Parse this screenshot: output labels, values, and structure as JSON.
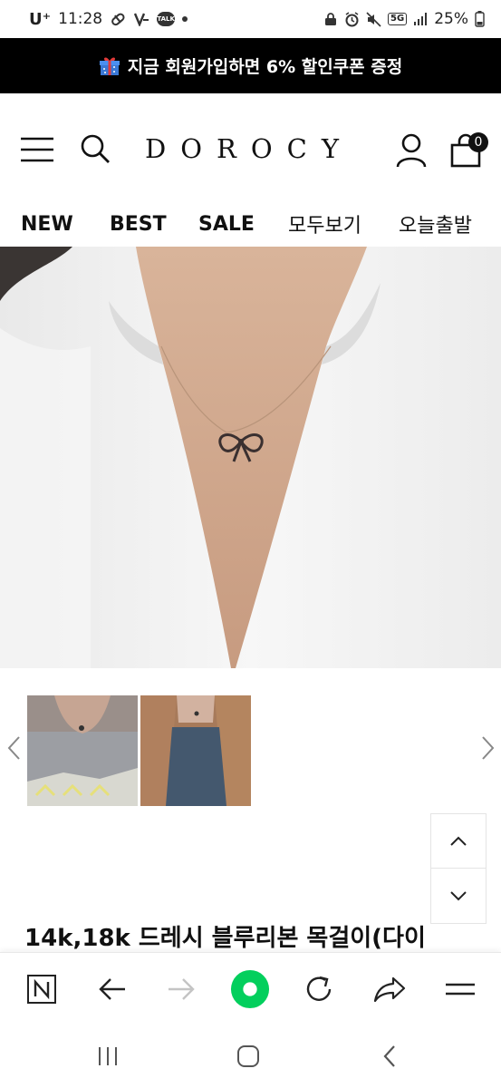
{
  "status_bar": {
    "carrier": "U⁺",
    "time": "11:28",
    "battery": "25%",
    "network": "5G",
    "talk_badge": "TALK"
  },
  "promo_banner": {
    "text": "지금 회원가입하면 6% 할인쿠폰 증정",
    "icon": "gift-icon"
  },
  "header": {
    "logo": "DOROCY",
    "cart_count": "0"
  },
  "nav": {
    "items": [
      "NEW",
      "BEST",
      "SALE",
      "모두보기",
      "오늘출발"
    ]
  },
  "product": {
    "title": "14k,18k 드레시 블루리본 목걸이(다이"
  },
  "colors": {
    "banner_bg": "#000000",
    "home_button": "#03cf5d",
    "text": "#111111"
  }
}
